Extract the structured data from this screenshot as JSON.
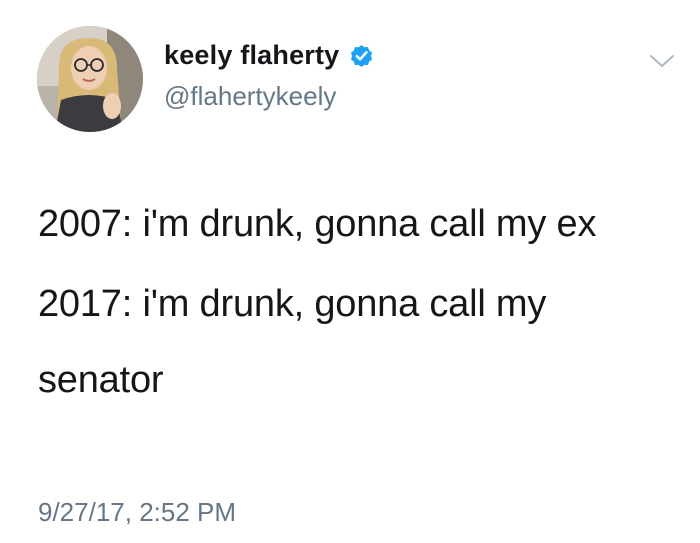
{
  "user": {
    "display_name": "keely flaherty",
    "handle": "@flahertykeely",
    "verified": true,
    "verified_color": "#1da1f2"
  },
  "tweet": {
    "paragraphs": [
      "2007: i'm drunk, gonna call my ex",
      "2017: i'm drunk, gonna call my senator"
    ],
    "timestamp": "9/27/17, 2:52 PM"
  },
  "icons": {
    "verified": "verified-badge-icon",
    "menu": "chevron-down-icon"
  },
  "colors": {
    "text": "#14171a",
    "secondary": "#657786",
    "background": "#ffffff"
  }
}
